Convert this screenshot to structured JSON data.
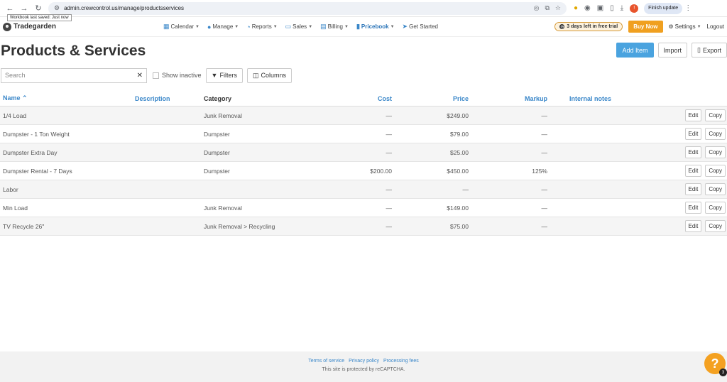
{
  "browser": {
    "url": "admin.crewcontrol.us/manage/productsservices",
    "finish_update": "Finish update",
    "tooltip": "Workbook last saved: Just now",
    "profile_initial": "!"
  },
  "header": {
    "brand": "Tradegarden",
    "nav": [
      {
        "label": "Calendar",
        "icon": "calendar-icon"
      },
      {
        "label": "Manage",
        "icon": "user-icon"
      },
      {
        "label": "Reports",
        "icon": "pie-chart-icon"
      },
      {
        "label": "Sales",
        "icon": "money-icon"
      },
      {
        "label": "Billing",
        "icon": "credit-card-icon"
      },
      {
        "label": "Pricebook",
        "icon": "book-icon"
      },
      {
        "label": "Get Started",
        "icon": "paper-plane-icon"
      }
    ],
    "trial": "3 days left in free trial",
    "buy_now": "Buy Now",
    "settings": "Settings",
    "logout": "Logout"
  },
  "page": {
    "title": "Products & Services",
    "add_item": "Add Item",
    "import": "Import",
    "export": "Export"
  },
  "filters": {
    "search_placeholder": "Search",
    "show_inactive": "Show inactive",
    "filters": "Filters",
    "columns": "Columns"
  },
  "table": {
    "headers": {
      "name": "Name",
      "description": "Description",
      "category": "Category",
      "cost": "Cost",
      "price": "Price",
      "markup": "Markup",
      "notes": "Internal notes"
    },
    "edit_label": "Edit",
    "copy_label": "Copy",
    "rows": [
      {
        "name": "1/4 Load",
        "description": "",
        "category": "Junk Removal",
        "cost": "—",
        "price": "$249.00",
        "markup": "—",
        "notes": ""
      },
      {
        "name": "Dumpster - 1 Ton Weight",
        "description": "",
        "category": "Dumpster",
        "cost": "—",
        "price": "$79.00",
        "markup": "—",
        "notes": ""
      },
      {
        "name": "Dumpster Extra Day",
        "description": "",
        "category": "Dumpster",
        "cost": "—",
        "price": "$25.00",
        "markup": "—",
        "notes": ""
      },
      {
        "name": "Dumpster Rental - 7 Days",
        "description": "",
        "category": "Dumpster",
        "cost": "$200.00",
        "price": "$450.00",
        "markup": "125%",
        "notes": ""
      },
      {
        "name": "Labor",
        "description": "",
        "category": "",
        "cost": "—",
        "price": "—",
        "markup": "—",
        "notes": ""
      },
      {
        "name": "Min Load",
        "description": "",
        "category": "Junk Removal",
        "cost": "—",
        "price": "$149.00",
        "markup": "—",
        "notes": ""
      },
      {
        "name": "TV Recycle 26\"",
        "description": "",
        "category": "Junk Removal > Recycling",
        "cost": "—",
        "price": "$75.00",
        "markup": "—",
        "notes": ""
      }
    ]
  },
  "footer": {
    "terms": "Terms of service",
    "privacy": "Privacy policy",
    "fees": "Processing fees",
    "captcha": "This site is protected by reCAPTCHA.",
    "help": "?",
    "help_badge": "3"
  },
  "colors": {
    "accent": "#3a87c9",
    "buy_now": "#f0a020",
    "primary_button": "#4aa3df"
  }
}
